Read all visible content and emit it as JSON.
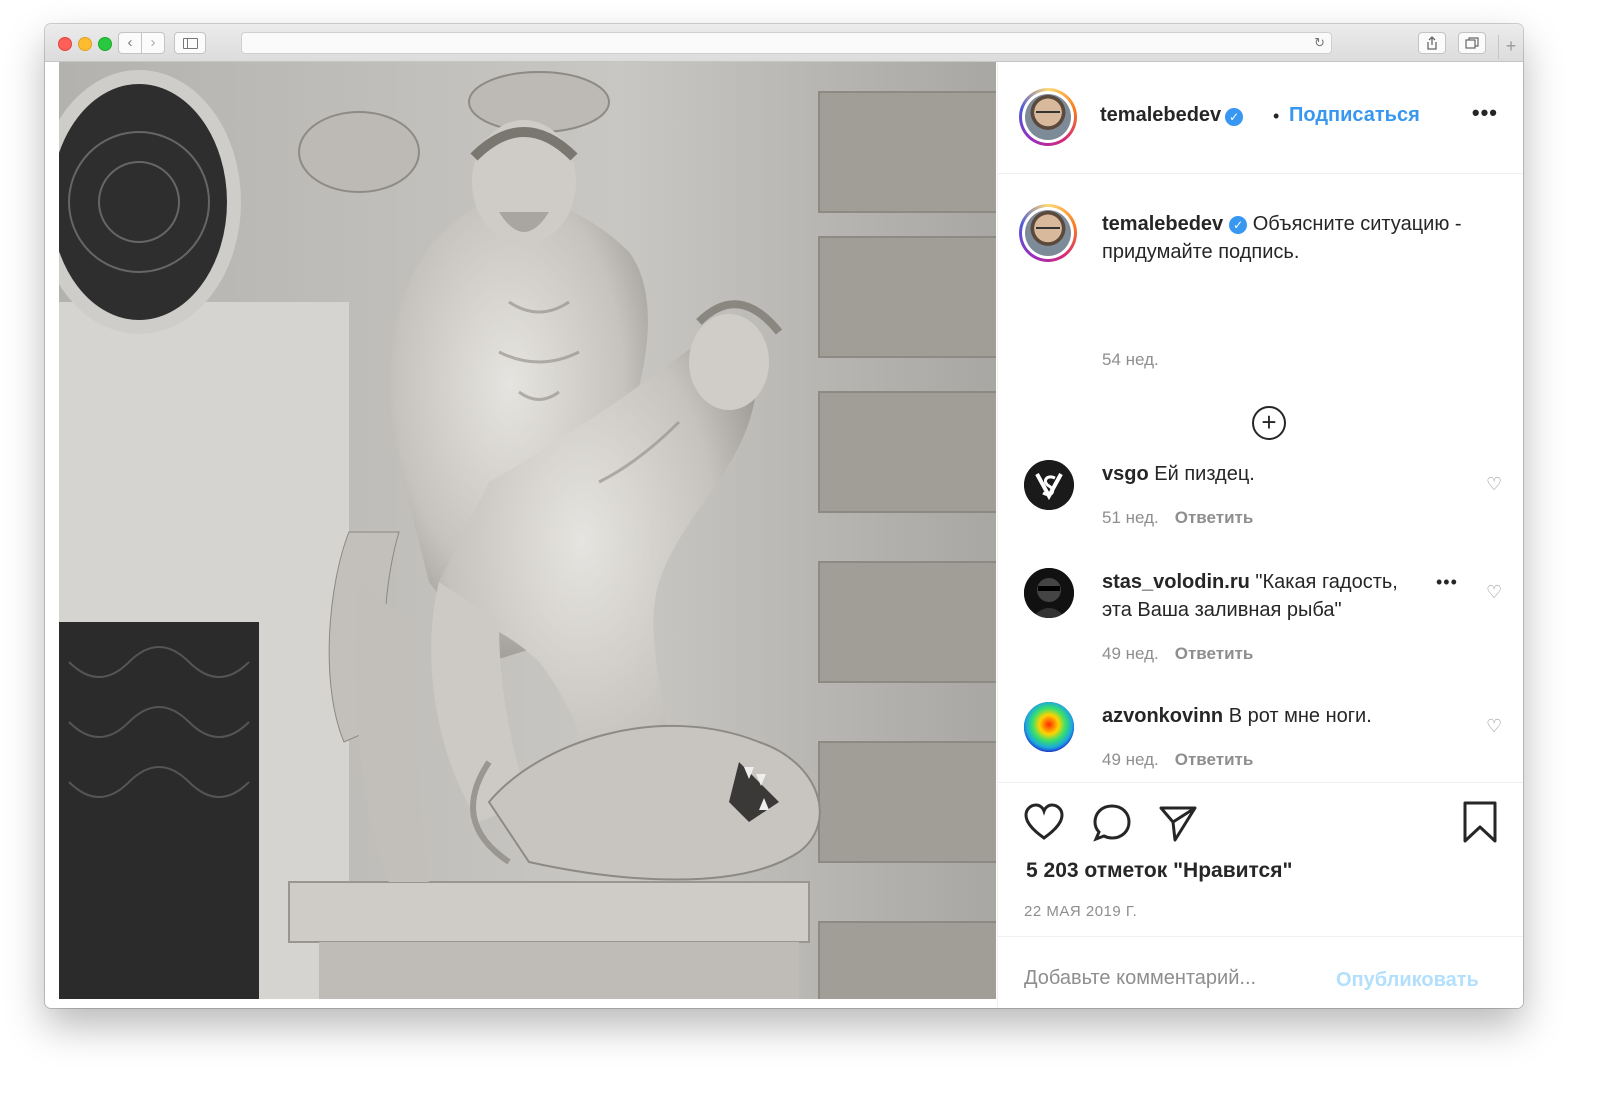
{
  "browser": {
    "url": ""
  },
  "post": {
    "author": "temalebedev",
    "follow_label": "Подписаться",
    "caption": "Объясните ситуацию - придумайте подпись.",
    "caption_time": "54 нед.",
    "likes": "5 203 отметок \"Нравится\"",
    "date": "22 МАЯ 2019 Г."
  },
  "comments": [
    {
      "user": "vsgo",
      "text": "Ей пиздец.",
      "time": "51 нед.",
      "reply": "Ответить"
    },
    {
      "user": "stas_volodin.ru",
      "text": "\"Какая гадость, эта Ваша заливная рыба\"",
      "time": "49 нед.",
      "reply": "Ответить"
    },
    {
      "user": "azvonkovinn",
      "text": "В рот мне ноги.",
      "time": "49 нед.",
      "reply": "Ответить"
    }
  ],
  "add_comment": {
    "placeholder": "Добавьте комментарий...",
    "post_label": "Опубликовать"
  },
  "icons": {
    "like": "heart-icon",
    "comment": "speech-bubble-icon",
    "share": "paper-plane-icon",
    "save": "bookmark-icon"
  },
  "colors": {
    "link_blue": "#3897f0",
    "muted": "#8e8e8e",
    "post_disabled": "#b2dffc"
  }
}
